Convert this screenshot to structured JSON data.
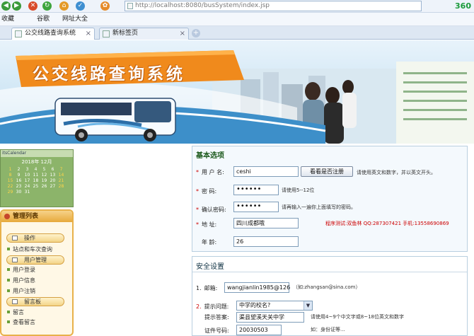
{
  "browser": {
    "address": "http://localhost:8080/busSystem/index.jsp",
    "brand": "360",
    "favorites": [
      "收藏",
      "谷歌",
      "网址大全"
    ],
    "tabs": [
      {
        "label": "公交线路查询系统",
        "active": true
      },
      {
        "label": "新标签页",
        "active": false
      }
    ]
  },
  "banner": {
    "title": "公交线路查询系统"
  },
  "sidebar": {
    "calendar": {
      "caption": "itsCalendar",
      "month": "2018年 12月",
      "days": [
        "1",
        "2",
        "3",
        "4",
        "5",
        "6",
        "7",
        "8",
        "9",
        "10",
        "11",
        "12",
        "13",
        "14",
        "15",
        "16",
        "17",
        "18",
        "19",
        "20",
        "21",
        "22",
        "23",
        "24",
        "25",
        "26",
        "27",
        "28",
        "29",
        "30",
        "31"
      ]
    },
    "panel_title": "管理列表",
    "groups": [
      {
        "label": "操作",
        "items": [
          "站点和车次查询"
        ]
      },
      {
        "label": "用户管理",
        "items": [
          "用户登录",
          "用户信息",
          "用户注销"
        ]
      },
      {
        "label": "留言板",
        "items": [
          "留言",
          "查看留言"
        ]
      }
    ]
  },
  "form": {
    "basic_title": "基本选项",
    "username": {
      "label": "用 户 名:",
      "value": "ceshi",
      "check_button": "看看是否注册",
      "hint": "请使用英文和数字，并以英文开头。"
    },
    "password": {
      "label": "密    码:",
      "value": "••••••",
      "hint": "请使用5--12位"
    },
    "confirm": {
      "label": "确认密码:",
      "value": "••••••",
      "hint": "请再输入一遍你上面填写的密码。"
    },
    "address": {
      "label": "地    址:",
      "value": "四川成都哦",
      "promo": "程序测试:双鱼林 QQ:287307421 手机:13558690869"
    },
    "age": {
      "label": "年    龄:",
      "value": "26"
    },
    "security_title": "安全设置",
    "email": {
      "num": "1.",
      "label": "邮箱:",
      "value": "wangjianlin1985@126",
      "hint": "（如:zhangsan@sina.com）"
    },
    "question": {
      "num": "2.",
      "label": "提示问题:",
      "value": "中学的校名?"
    },
    "answer": {
      "label": "提示答案:",
      "value": "渠县望溪天关中学",
      "hint": "请使用4~9个中文字或8~18位英文和数字"
    },
    "idcard": {
      "label": "证件号码:",
      "value": "20030503",
      "hint": "如：身份证等..."
    }
  }
}
